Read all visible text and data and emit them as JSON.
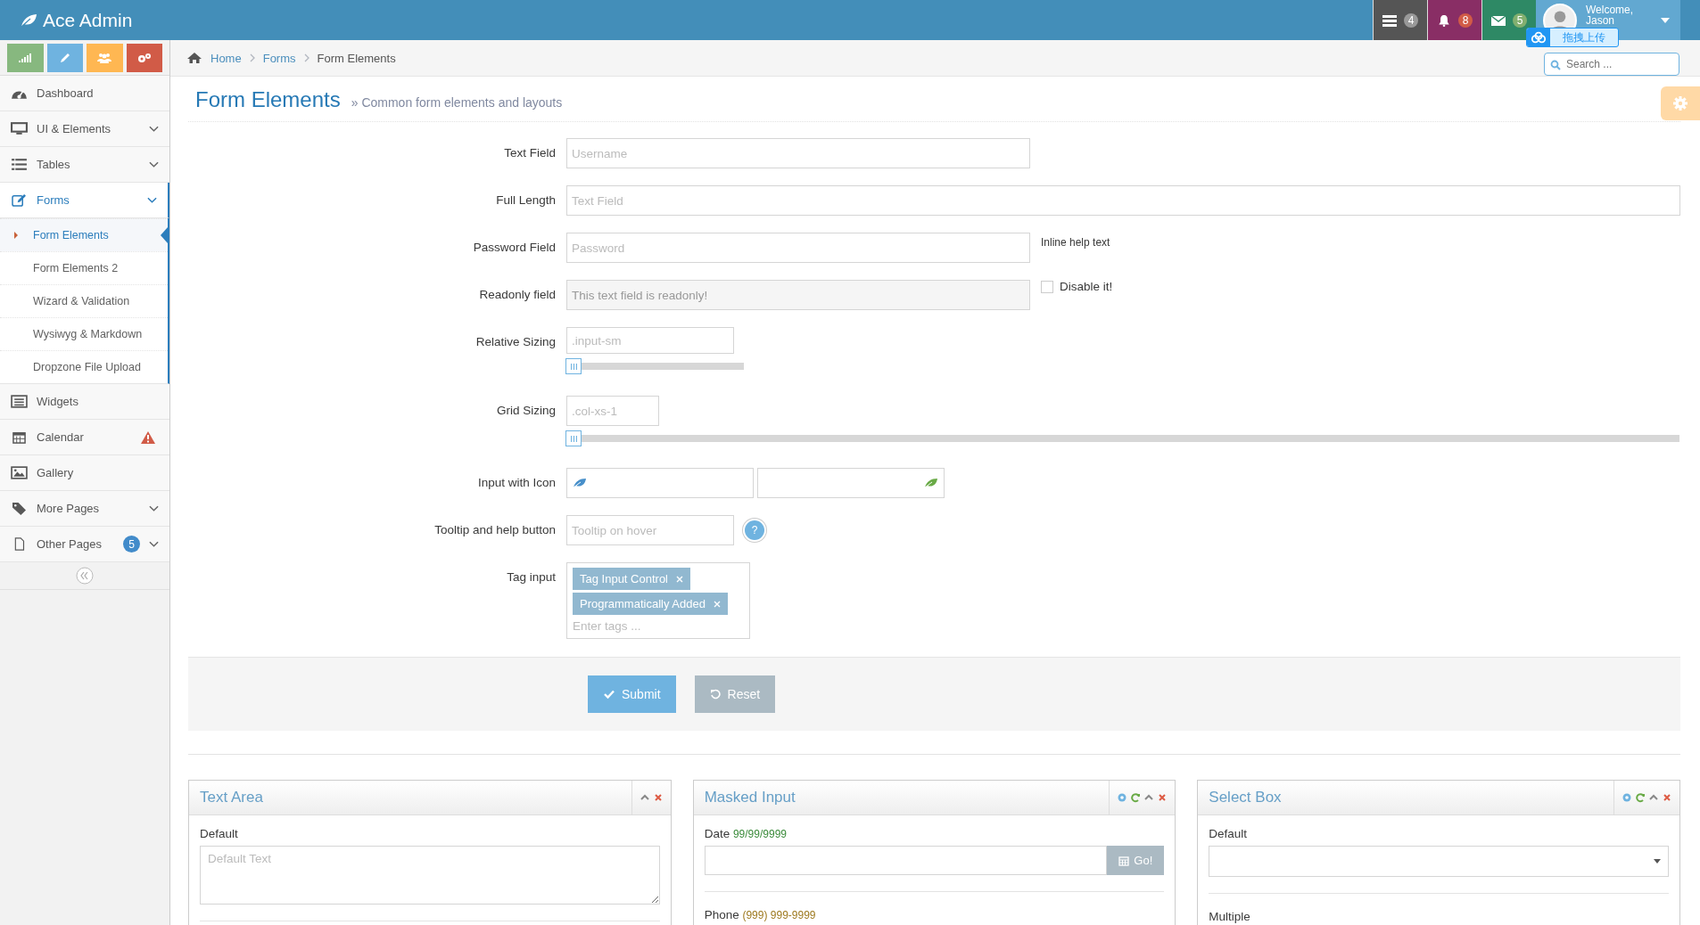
{
  "navbar": {
    "brand": "Ace Admin",
    "badges": [
      {
        "count": "4",
        "color": "#555555"
      },
      {
        "count": "8",
        "color": "#892e65"
      },
      {
        "count": "5",
        "color": "#2e8965"
      }
    ],
    "user": {
      "greeting": "Welcome,",
      "name": "Jason"
    },
    "upload_overlay": {
      "label": "拖拽上传"
    }
  },
  "shortcuts": [
    {
      "color": "#87b87f"
    },
    {
      "color": "#6fb3e0"
    },
    {
      "color": "#ffb752"
    },
    {
      "color": "#d15b47"
    }
  ],
  "sidebar": {
    "items": [
      {
        "label": "Dashboard",
        "has_arrow": false,
        "selected": false
      },
      {
        "label": "UI & Elements",
        "has_arrow": true,
        "selected": false
      },
      {
        "label": "Tables",
        "has_arrow": true,
        "selected": false
      },
      {
        "label": "Forms",
        "has_arrow": true,
        "selected": true,
        "expanded": true,
        "children": [
          {
            "label": "Form Elements",
            "selected": true
          },
          {
            "label": "Form Elements 2",
            "selected": false
          },
          {
            "label": "Wizard & Validation",
            "selected": false
          },
          {
            "label": "Wysiwyg & Markdown",
            "selected": false
          },
          {
            "label": "Dropzone File Upload",
            "selected": false
          }
        ]
      },
      {
        "label": "Widgets",
        "has_arrow": false,
        "selected": false
      },
      {
        "label": "Calendar",
        "has_arrow": false,
        "selected": false,
        "warning": true
      },
      {
        "label": "Gallery",
        "has_arrow": false,
        "selected": false
      },
      {
        "label": "More Pages",
        "has_arrow": true,
        "selected": false
      },
      {
        "label": "Other Pages",
        "has_arrow": true,
        "selected": false,
        "badge": "5"
      }
    ]
  },
  "breadcrumb": [
    {
      "label": "Home",
      "link": true
    },
    {
      "label": "Forms",
      "link": true
    },
    {
      "label": "Form Elements",
      "link": false
    }
  ],
  "search": {
    "placeholder": "Search ..."
  },
  "page_header": {
    "title": "Form Elements",
    "subtitle": "» Common form elements and layouts"
  },
  "form": {
    "rows": [
      {
        "kind": "text",
        "label": "Text Field",
        "placeholder": "Username"
      },
      {
        "kind": "full",
        "label": "Full Length",
        "placeholder": "Text Field"
      },
      {
        "kind": "password",
        "label": "Password Field",
        "placeholder": "Password",
        "help": "Inline help text"
      },
      {
        "kind": "readonly",
        "label": "Readonly field",
        "value": "This text field is readonly!",
        "checkbox": {
          "label": "Disable it!",
          "checked": false
        }
      },
      {
        "kind": "slider-small",
        "label": "Relative Sizing",
        "placeholder": ".input-sm",
        "level": 0
      },
      {
        "kind": "slider-grid",
        "label": "Grid Sizing",
        "placeholder": ".col-xs-1",
        "level": 0
      },
      {
        "kind": "icons",
        "label": "Input with Icon"
      },
      {
        "kind": "tooltip",
        "label": "Tooltip and help button",
        "placeholder": "Tooltip on hover",
        "help_mark": "?"
      },
      {
        "kind": "tags",
        "label": "Tag input",
        "tags": [
          "Tag Input Control",
          "Programmatically Added"
        ],
        "placeholder": "Enter tags ..."
      }
    ],
    "buttons": [
      {
        "label": "Submit",
        "kind": "primary"
      },
      {
        "label": "Reset",
        "kind": "default"
      }
    ]
  },
  "widgets": [
    {
      "title": "Text Area",
      "label": "Default",
      "placeholder": "Default Text"
    },
    {
      "title": "Masked Input",
      "label": "Date",
      "mask": "99/99/9999",
      "button": "Go!",
      "label_2": "Phone",
      "mask_2": "(999) 999-9999"
    },
    {
      "title": "Select Box",
      "label": "Default",
      "label_2": "Multiple"
    }
  ]
}
